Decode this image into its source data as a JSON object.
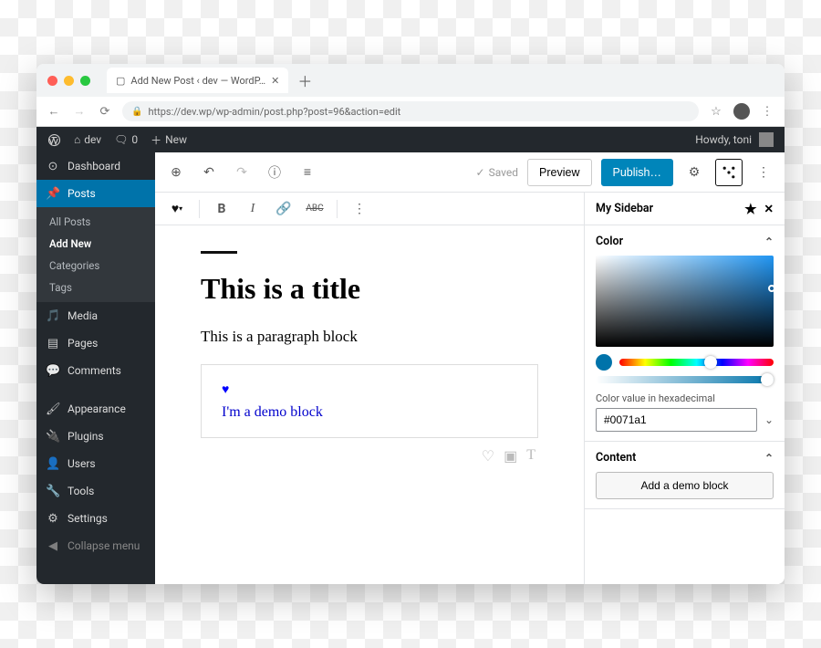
{
  "browser": {
    "tab_title": "Add New Post ‹ dev — WordP…",
    "url": "https://dev.wp/wp-admin/post.php?post=96&action=edit"
  },
  "admin_bar": {
    "site": "dev",
    "comments": "0",
    "new_label": "New",
    "howdy": "Howdy, toni"
  },
  "sidebar": {
    "items": [
      {
        "icon": "dashboard",
        "label": "Dashboard"
      },
      {
        "icon": "pin",
        "label": "Posts",
        "active": true
      },
      {
        "icon": "media",
        "label": "Media"
      },
      {
        "icon": "page",
        "label": "Pages"
      },
      {
        "icon": "comment",
        "label": "Comments"
      },
      {
        "icon": "brush",
        "label": "Appearance"
      },
      {
        "icon": "plug",
        "label": "Plugins"
      },
      {
        "icon": "user",
        "label": "Users"
      },
      {
        "icon": "wrench",
        "label": "Tools"
      },
      {
        "icon": "gear",
        "label": "Settings"
      },
      {
        "icon": "collapse",
        "label": "Collapse menu"
      }
    ],
    "posts_submenu": [
      "All Posts",
      "Add New",
      "Categories",
      "Tags"
    ],
    "posts_submenu_selected": 1
  },
  "editor_top": {
    "saved": "Saved",
    "preview": "Preview",
    "publish": "Publish…"
  },
  "content": {
    "title": "This is a title",
    "paragraph": "This is a paragraph block",
    "demo_text": "I'm a demo block"
  },
  "panel": {
    "title": "My Sidebar",
    "sections": {
      "color": {
        "title": "Color",
        "hex_label": "Color value in hexadecimal",
        "hex_value": "#0071a1",
        "selected_color": "#0071a1"
      },
      "content": {
        "title": "Content",
        "button": "Add a demo block"
      }
    }
  }
}
